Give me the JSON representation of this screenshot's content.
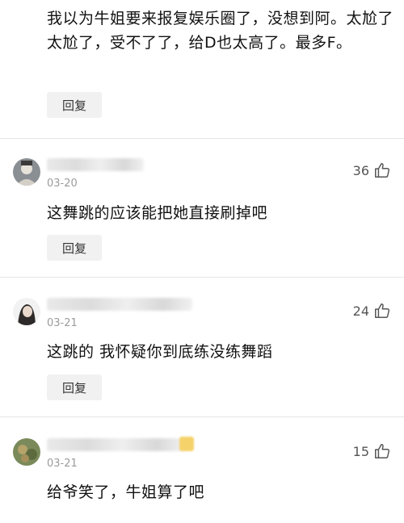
{
  "comment0": {
    "text": "我以为牛姐要来报复娱乐圈了，没想到阿。太尬了太尬了，受不了了，给D也太高了。最多F。",
    "reply_label": "回复"
  },
  "comments": [
    {
      "date": "03-20",
      "likes": "36",
      "text": "这舞跳的应该能把她直接刷掉吧",
      "reply_label": "回复"
    },
    {
      "date": "03-21",
      "likes": "24",
      "text": "这跳的 我怀疑你到底练没练舞蹈",
      "reply_label": "回复"
    },
    {
      "date": "03-21",
      "likes": "15",
      "text": "给爷笑了，牛姐算了吧"
    }
  ],
  "icons": {
    "like": "thumbs-up-icon"
  },
  "colors": {
    "reply_bg": "#f1f1f1",
    "date": "#9b9b9b",
    "divider": "#e6e6e6"
  }
}
